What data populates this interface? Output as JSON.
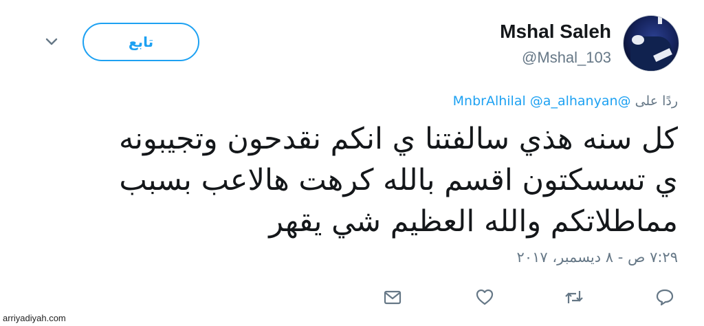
{
  "user": {
    "name": "Mshal Saleh",
    "handle": "@Mshal_103"
  },
  "follow_button_label": "تابع",
  "reply": {
    "prefix": "ردًا على",
    "mentions": [
      "@MnbrAlhilal",
      "@a_alhanyan"
    ]
  },
  "tweet": {
    "lines": [
      "كل سنه هذي سالفتنا ي انكم نقدحون وتجيبونه",
      "ي تسسكتون اقسم بالله كرهت هالاعب بسبب",
      "مماطلاتكم والله العظيم شي يقهر"
    ]
  },
  "timestamp": "٧:٢٩ ص - ٨ ديسمبر، ٢٠١٧",
  "actions": [
    "reply-icon",
    "retweet-icon",
    "like-icon",
    "message-icon"
  ],
  "watermark": "arriyadiyah.com",
  "colors": {
    "accent": "#1da1f2",
    "muted": "#657786",
    "text": "#14171a"
  }
}
